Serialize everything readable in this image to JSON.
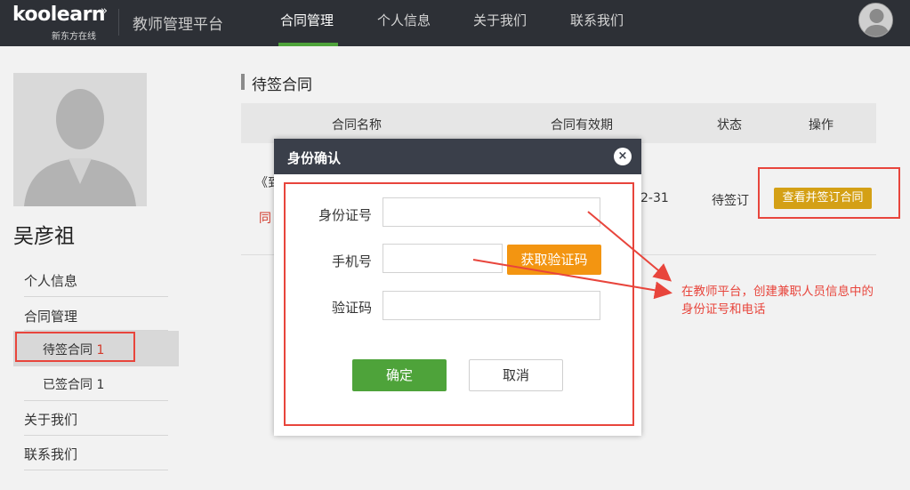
{
  "header": {
    "logo_text": "koolearn",
    "logo_sub": "新东方在线",
    "platform_title": "教师管理平台",
    "nav": [
      {
        "label": "合同管理",
        "active": true
      },
      {
        "label": "个人信息",
        "active": false
      },
      {
        "label": "关于我们",
        "active": false
      },
      {
        "label": "联系我们",
        "active": false
      }
    ]
  },
  "sidebar": {
    "user_name": "吴彦祖",
    "items": [
      {
        "label": "个人信息"
      },
      {
        "label": "合同管理"
      },
      {
        "label": "待签合同",
        "count": "1"
      },
      {
        "label": "已签合同",
        "count": "1"
      },
      {
        "label": "关于我们"
      },
      {
        "label": "联系我们"
      }
    ]
  },
  "main": {
    "section_title": "待签合同",
    "columns": [
      "合同名称",
      "合同有效期",
      "状态",
      "操作"
    ],
    "row": {
      "name_fragment_1": "《到",
      "name_fragment_2": "同",
      "validity_fragment": "2-31",
      "status": "待签订",
      "action_label": "查看并签订合同"
    }
  },
  "modal": {
    "title": "身份确认",
    "close_icon": "×",
    "id_label": "身份证号",
    "id_value": "",
    "phone_label": "手机号",
    "phone_value": "",
    "get_code_label": "获取验证码",
    "code_label": "验证码",
    "code_value": "",
    "confirm_label": "确定",
    "cancel_label": "取消"
  },
  "annotation": {
    "line1": "在教师平台，创建兼职人员信息中的",
    "line2": "身份证号和电话"
  },
  "colors": {
    "topbar": "#2d3036",
    "accent_green": "#4ea33a",
    "orange": "#f39511",
    "gold": "#d4a015",
    "annotation_red": "#e8453c"
  }
}
